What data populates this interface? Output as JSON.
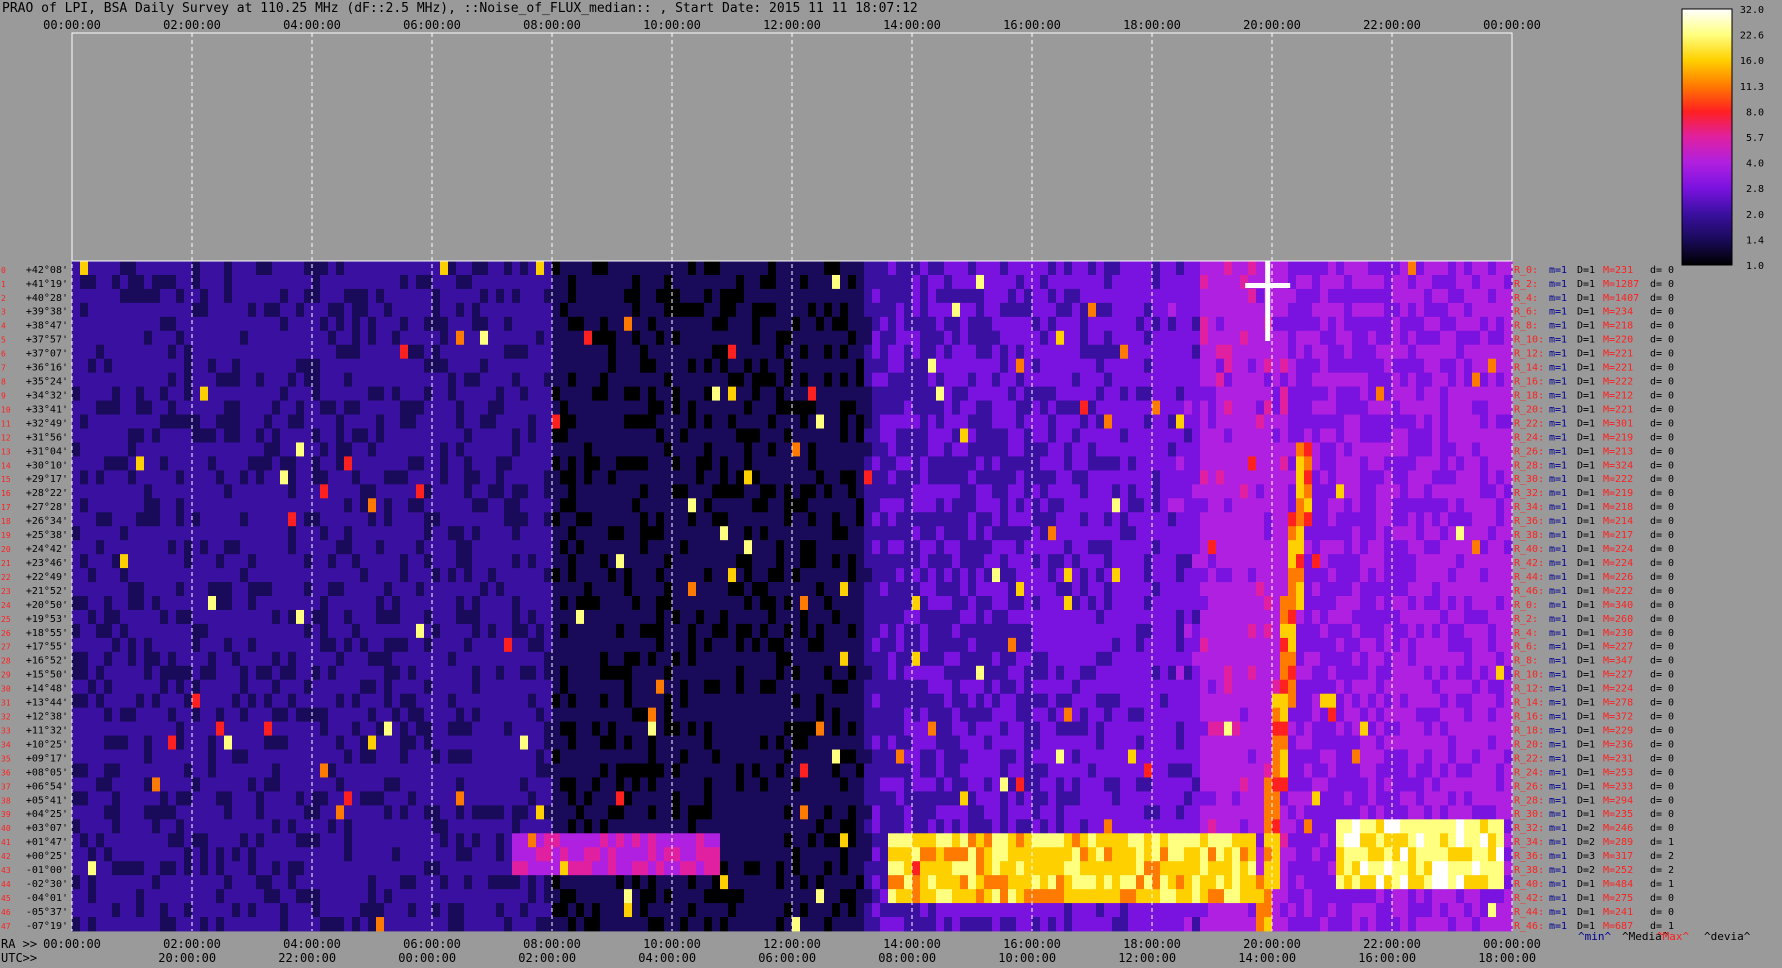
{
  "title": "PRAO of LPI, BSA Daily Survey at 110.25 MHz (dF::2.5 MHz), ::Noise_of_FLUX_median:: , Start Date: 2015 11 11 18:07:12",
  "chart_data": {
    "type": "heatmap",
    "top_axis_ticks": [
      "00:00:00",
      "02:00:00",
      "04:00:00",
      "06:00:00",
      "08:00:00",
      "10:00:00",
      "12:00:00",
      "14:00:00",
      "16:00:00",
      "18:00:00",
      "20:00:00",
      "22:00:00",
      "00:00:00"
    ],
    "ra_axis_label": "RA >>",
    "ra_ticks": [
      "00:00:00",
      "02:00:00",
      "04:00:00",
      "06:00:00",
      "08:00:00",
      "10:00:00",
      "12:00:00",
      "14:00:00",
      "16:00:00",
      "18:00:00",
      "20:00:00",
      "22:00:00",
      "00:00:00"
    ],
    "utc_axis_label": "UTC>>",
    "utc_ticks": [
      "20:00:00",
      "22:00:00",
      "00:00:00",
      "02:00:00",
      "04:00:00",
      "06:00:00",
      "08:00:00",
      "10:00:00",
      "12:00:00",
      "14:00:00",
      "16:00:00",
      "18:00:00"
    ],
    "declinations": [
      "+42°08'",
      "+41°19'",
      "+40°28'",
      "+39°38'",
      "+38°47'",
      "+37°57'",
      "+37°07'",
      "+36°16'",
      "+35°24'",
      "+34°32'",
      "+33°41'",
      "+32°49'",
      "+31°56'",
      "+31°04'",
      "+30°10'",
      "+29°17'",
      "+28°22'",
      "+27°28'",
      "+26°34'",
      "+25°38'",
      "+24°42'",
      "+23°46'",
      "+22°49'",
      "+21°52'",
      "+20°50'",
      "+19°53'",
      "+18°55'",
      "+17°55'",
      "+16°52'",
      "+15°50'",
      "+14°48'",
      "+13°44'",
      "+12°38'",
      "+11°32'",
      "+10°25'",
      "+09°17'",
      "+08°05'",
      "+06°54'",
      "+05°41'",
      "+04°25'",
      "+03°07'",
      "+01°47'",
      "+00°25'",
      "-01°00'",
      "-02°30'",
      "-04°01'",
      "-05°37'",
      "-07°19'"
    ],
    "beam_numbers": [
      "0",
      "1",
      "2",
      "3",
      "4",
      "5",
      "6",
      "7",
      "8",
      "9",
      "10",
      "11",
      "12",
      "13",
      "14",
      "15",
      "16",
      "17",
      "18",
      "19",
      "20",
      "21",
      "22",
      "23",
      "24",
      "25",
      "26",
      "27",
      "28",
      "29",
      "30",
      "31",
      "32",
      "33",
      "34",
      "35",
      "36",
      "37",
      "38",
      "39",
      "40",
      "41",
      "42",
      "43",
      "44",
      "45",
      "46",
      "47"
    ],
    "stats_rows": [
      {
        "r": "R_0:",
        "m": "m=1",
        "D": "D=1",
        "M": "M=231",
        "d": "d= 0"
      },
      {
        "r": "R_2:",
        "m": "m=1",
        "D": "D=1",
        "M": "M=1287",
        "d": "d= 0"
      },
      {
        "r": "R_4:",
        "m": "m=1",
        "D": "D=1",
        "M": "M=1407",
        "d": "d= 0"
      },
      {
        "r": "R_6:",
        "m": "m=1",
        "D": "D=1",
        "M": "M=234",
        "d": "d= 0"
      },
      {
        "r": "R_8:",
        "m": "m=1",
        "D": "D=1",
        "M": "M=218",
        "d": "d= 0"
      },
      {
        "r": "R_10:",
        "m": "m=1",
        "D": "D=1",
        "M": "M=220",
        "d": "d= 0"
      },
      {
        "r": "R_12:",
        "m": "m=1",
        "D": "D=1",
        "M": "M=221",
        "d": "d= 0"
      },
      {
        "r": "R_14:",
        "m": "m=1",
        "D": "D=1",
        "M": "M=221",
        "d": "d= 0"
      },
      {
        "r": "R_16:",
        "m": "m=1",
        "D": "D=1",
        "M": "M=222",
        "d": "d= 0"
      },
      {
        "r": "R_18:",
        "m": "m=1",
        "D": "D=1",
        "M": "M=212",
        "d": "d= 0"
      },
      {
        "r": "R_20:",
        "m": "m=1",
        "D": "D=1",
        "M": "M=221",
        "d": "d= 0"
      },
      {
        "r": "R_22:",
        "m": "m=1",
        "D": "D=1",
        "M": "M=301",
        "d": "d= 0"
      },
      {
        "r": "R_24:",
        "m": "m=1",
        "D": "D=1",
        "M": "M=219",
        "d": "d= 0"
      },
      {
        "r": "R_26:",
        "m": "m=1",
        "D": "D=1",
        "M": "M=213",
        "d": "d= 0"
      },
      {
        "r": "R_28:",
        "m": "m=1",
        "D": "D=1",
        "M": "M=324",
        "d": "d= 0"
      },
      {
        "r": "R_30:",
        "m": "m=1",
        "D": "D=1",
        "M": "M=222",
        "d": "d= 0"
      },
      {
        "r": "R_32:",
        "m": "m=1",
        "D": "D=1",
        "M": "M=219",
        "d": "d= 0"
      },
      {
        "r": "R_34:",
        "m": "m=1",
        "D": "D=1",
        "M": "M=218",
        "d": "d= 0"
      },
      {
        "r": "R_36:",
        "m": "m=1",
        "D": "D=1",
        "M": "M=214",
        "d": "d= 0"
      },
      {
        "r": "R_38:",
        "m": "m=1",
        "D": "D=1",
        "M": "M=217",
        "d": "d= 0"
      },
      {
        "r": "R_40:",
        "m": "m=1",
        "D": "D=1",
        "M": "M=224",
        "d": "d= 0"
      },
      {
        "r": "R_42:",
        "m": "m=1",
        "D": "D=1",
        "M": "M=224",
        "d": "d= 0"
      },
      {
        "r": "R_44:",
        "m": "m=1",
        "D": "D=1",
        "M": "M=226",
        "d": "d= 0"
      },
      {
        "r": "R_46:",
        "m": "m=1",
        "D": "D=1",
        "M": "M=222",
        "d": "d= 0"
      },
      {
        "r": "R_0:",
        "m": "m=1",
        "D": "D=1",
        "M": "M=340",
        "d": "d= 0"
      },
      {
        "r": "R_2:",
        "m": "m=1",
        "D": "D=1",
        "M": "M=260",
        "d": "d= 0"
      },
      {
        "r": "R_4:",
        "m": "m=1",
        "D": "D=1",
        "M": "M=230",
        "d": "d= 0"
      },
      {
        "r": "R_6:",
        "m": "m=1",
        "D": "D=1",
        "M": "M=227",
        "d": "d= 0"
      },
      {
        "r": "R_8:",
        "m": "m=1",
        "D": "D=1",
        "M": "M=347",
        "d": "d= 0"
      },
      {
        "r": "R_10:",
        "m": "m=1",
        "D": "D=1",
        "M": "M=227",
        "d": "d= 0"
      },
      {
        "r": "R_12:",
        "m": "m=1",
        "D": "D=1",
        "M": "M=224",
        "d": "d= 0"
      },
      {
        "r": "R_14:",
        "m": "m=1",
        "D": "D=1",
        "M": "M=278",
        "d": "d= 0"
      },
      {
        "r": "R_16:",
        "m": "m=1",
        "D": "D=1",
        "M": "M=372",
        "d": "d= 0"
      },
      {
        "r": "R_18:",
        "m": "m=1",
        "D": "D=1",
        "M": "M=229",
        "d": "d= 0"
      },
      {
        "r": "R_20:",
        "m": "m=1",
        "D": "D=1",
        "M": "M=236",
        "d": "d= 0"
      },
      {
        "r": "R_22:",
        "m": "m=1",
        "D": "D=1",
        "M": "M=231",
        "d": "d= 0"
      },
      {
        "r": "R_24:",
        "m": "m=1",
        "D": "D=1",
        "M": "M=253",
        "d": "d= 0"
      },
      {
        "r": "R_26:",
        "m": "m=1",
        "D": "D=1",
        "M": "M=233",
        "d": "d= 0"
      },
      {
        "r": "R_28:",
        "m": "m=1",
        "D": "D=1",
        "M": "M=294",
        "d": "d= 0"
      },
      {
        "r": "R_30:",
        "m": "m=1",
        "D": "D=1",
        "M": "M=235",
        "d": "d= 0"
      },
      {
        "r": "R_32:",
        "m": "m=1",
        "D": "D=2",
        "M": "M=246",
        "d": "d= 0"
      },
      {
        "r": "R_34:",
        "m": "m=1",
        "D": "D=2",
        "M": "M=289",
        "d": "d= 1"
      },
      {
        "r": "R_36:",
        "m": "m=1",
        "D": "D=3",
        "M": "M=317",
        "d": "d= 2"
      },
      {
        "r": "R_38:",
        "m": "m=1",
        "D": "D=2",
        "M": "M=252",
        "d": "d= 2"
      },
      {
        "r": "R_40:",
        "m": "m=1",
        "D": "D=1",
        "M": "M=484",
        "d": "d= 1"
      },
      {
        "r": "R_42:",
        "m": "m=1",
        "D": "D=1",
        "M": "M=275",
        "d": "d= 0"
      },
      {
        "r": "R_44:",
        "m": "m=1",
        "D": "D=1",
        "M": "M=241",
        "d": "d= 0"
      },
      {
        "r": "R_46:",
        "m": "m=1",
        "D": "D=1",
        "M": "M=687",
        "d": "d= 1"
      }
    ],
    "stats_legend": [
      "^min^",
      "^Media^",
      "^Max^",
      "^devia^"
    ],
    "colorbar_labels": [
      "32.0",
      "22.6",
      "16.0",
      "11.3",
      "8.0",
      "5.7",
      "4.0",
      "2.8",
      "2.0",
      "1.4",
      "1.0"
    ],
    "colorbar_colors": [
      "#000000",
      "#1a0a5a",
      "#3a10a0",
      "#7a12e0",
      "#b020e0",
      "#e020a0",
      "#ff2020",
      "#ff7a00",
      "#ffd000",
      "#ffff80",
      "#ffffff"
    ],
    "colors": {
      "background": "#9a9a9a",
      "stat_red": "#ff2020",
      "stat_blue": "#000090",
      "stat_black": "#000000"
    }
  }
}
